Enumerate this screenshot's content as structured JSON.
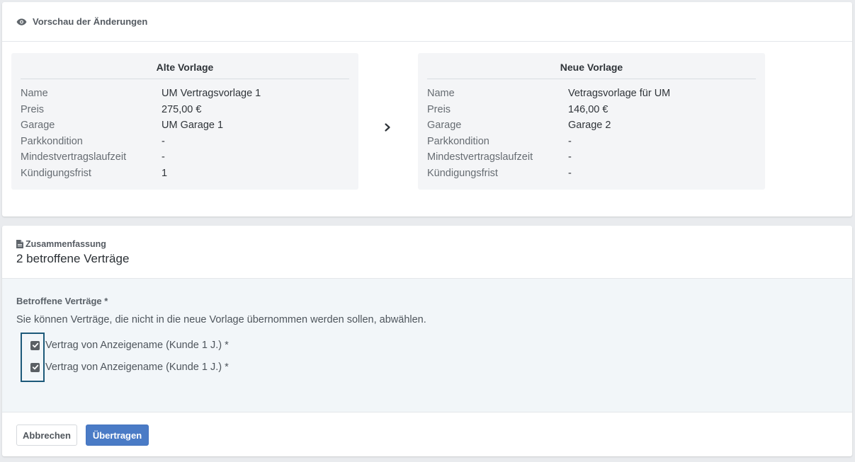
{
  "preview": {
    "title": "Vorschau der Änderungen",
    "icon": "eye-icon",
    "old_template": {
      "heading": "Alte Vorlage",
      "rows": [
        {
          "key": "Name",
          "value": "UM Vertragsvorlage 1"
        },
        {
          "key": "Preis",
          "value": "275,00 €"
        },
        {
          "key": "Garage",
          "value": "UM Garage 1"
        },
        {
          "key": "Parkkondition",
          "value": "-"
        },
        {
          "key": "Mindestvertragslaufzeit",
          "value": "-"
        },
        {
          "key": "Kündigungsfrist",
          "value": "1"
        }
      ]
    },
    "arrow_icon": "chevron-right-icon",
    "new_template": {
      "heading": "Neue Vorlage",
      "rows": [
        {
          "key": "Name",
          "value": "Vetragsvorlage für UM"
        },
        {
          "key": "Preis",
          "value": "146,00 €"
        },
        {
          "key": "Garage",
          "value": "Garage 2"
        },
        {
          "key": "Parkkondition",
          "value": "-"
        },
        {
          "key": "Mindestvertragslaufzeit",
          "value": "-"
        },
        {
          "key": "Kündigungsfrist",
          "value": "-"
        }
      ]
    }
  },
  "summary": {
    "label": "Zusammenfassung",
    "icon": "document-icon",
    "title": "2 betroffene Verträge",
    "field_label": "Betroffene Verträge *",
    "help_text": "Sie können Verträge, die nicht in die neue Vorlage übernommen werden sollen, abwählen.",
    "contracts": [
      {
        "label": "Vertrag von Anzeigename (Kunde 1 J.) *",
        "checked": true
      },
      {
        "label": "Vertrag von Anzeigename (Kunde 1 J.) *",
        "checked": true
      }
    ]
  },
  "actions": {
    "cancel_label": "Abbrechen",
    "transfer_label": "Übertragen"
  },
  "colors": {
    "primary_button": "#4a7bc6",
    "focus_outline": "#1d5a7a",
    "panel_bg": "#f4f5f7",
    "form_bg": "#f2f6f9"
  }
}
